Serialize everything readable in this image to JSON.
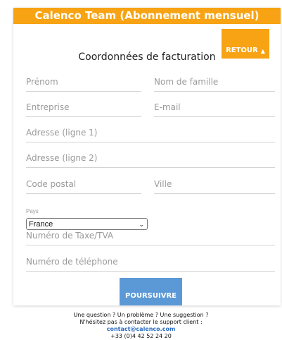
{
  "header": {
    "title": "Calenco Team (Abonnement mensuel)"
  },
  "back_button": {
    "label": "RETOUR",
    "icon": "triangle-up-icon"
  },
  "section_title": "Coordonnées de facturation",
  "fields": {
    "first_name": "Prénom",
    "last_name": "Nom de famille",
    "company": "Entreprise",
    "email": "E-mail",
    "address1": "Adresse (ligne 1)",
    "address2": "Adresse (ligne 2)",
    "postal_code": "Code postal",
    "city": "Ville",
    "country_label": "Pays",
    "country_value": "France",
    "tax_id": "Numéro de Taxe/TVA",
    "phone": "Numéro de téléphone"
  },
  "submit_button": {
    "label": "POURSUIVRE"
  },
  "footer": {
    "line1": "Une question ? Un problème ? Une suggestion ?",
    "line2": "N'hésitez pas à contacter le support client :",
    "email": "contact@calenco.com",
    "phone": "+33 (0)4 42 52 24 20"
  },
  "colors": {
    "accent": "#f7a313",
    "primary_button": "#5b99d6",
    "link": "#2b6cc4"
  }
}
